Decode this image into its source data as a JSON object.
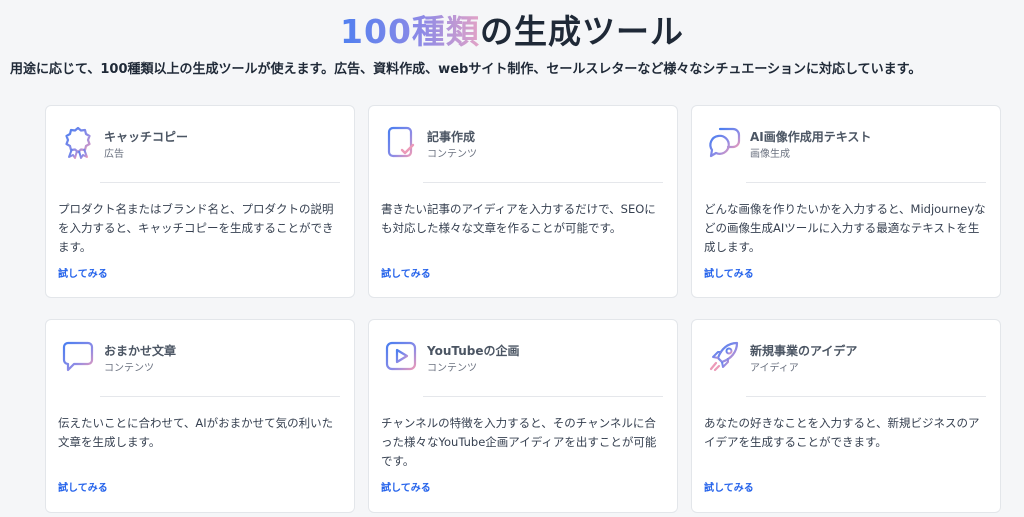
{
  "header": {
    "title_highlight": "100種類",
    "title_rest": "の生成ツール",
    "subtitle": "用途に応じて、100種類以上の生成ツールが使えます。広告、資料作成、webサイト制作、セールスレターなど様々なシチュエーションに対応しています。"
  },
  "cards": [
    {
      "icon": "award-ribbon-icon",
      "name": "キャッチコピー",
      "category": "広告",
      "description": "プロダクト名またはブランド名と、プロダクトの説明を入力すると、キャッチコピーを生成することができます。",
      "cta": "試してみる"
    },
    {
      "icon": "document-check-icon",
      "name": "記事作成",
      "category": "コンテンツ",
      "description": "書きたい記事のアイディアを入力するだけで、SEOにも対応した様々な文章を作ることが可能です。",
      "cta": "試してみる"
    },
    {
      "icon": "speech-bubbles-icon",
      "name": "AI画像作成用テキスト",
      "category": "画像生成",
      "description": "どんな画像を作りたいかを入力すると、Midjourneyなどの画像生成AIツールに入力する最適なテキストを生成します。",
      "cta": "試してみる"
    },
    {
      "icon": "chat-lines-icon",
      "name": "おまかせ文章",
      "category": "コンテンツ",
      "description": "伝えたいことに合わせて、AIがおまかせて気の利いた文章を生成します。",
      "cta": "試してみる"
    },
    {
      "icon": "video-play-icon",
      "name": "YouTubeの企画",
      "category": "コンテンツ",
      "description": "チャンネルの特徴を入力すると、そのチャンネルに合った様々なYouTube企画アイディアを出すことが可能です。",
      "cta": "試してみる"
    },
    {
      "icon": "rocket-icon",
      "name": "新規事業のアイデア",
      "category": "アイディア",
      "description": "あなたの好きなことを入力すると、新規ビジネスのアイデアを生成することができます。",
      "cta": "試してみる"
    }
  ]
}
